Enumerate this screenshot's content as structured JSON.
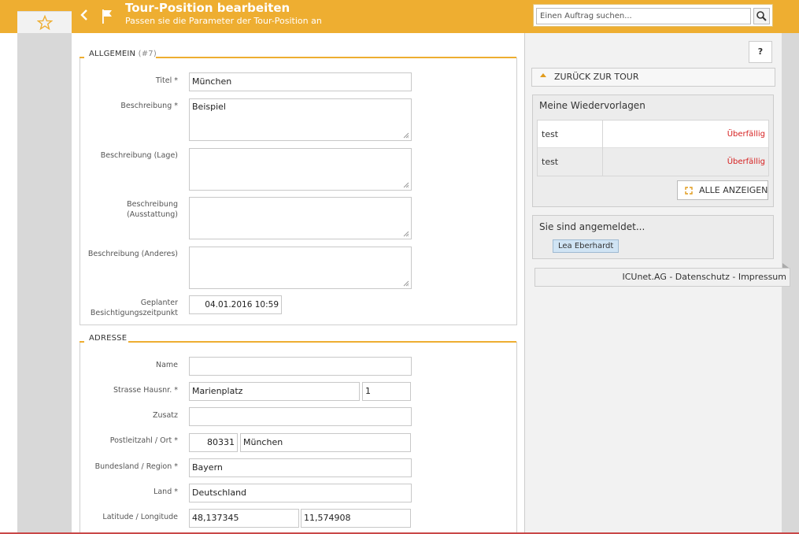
{
  "header": {
    "title": "Tour-Position bearbeiten",
    "subtitle": "Passen sie die Parameter der Tour-Position an",
    "search_placeholder": "Einen Auftrag suchen...",
    "accent_color": "#eeae31"
  },
  "general": {
    "title": "ALLGEMEIN",
    "count": "(#7)",
    "titel_label": "Titel *",
    "titel_value": "München",
    "beschreibung_label": "Beschreibung *",
    "beschreibung_value": "Beispiel",
    "lage_label": "Beschreibung (Lage)",
    "lage_value": "",
    "ausstattung_label_1": "Beschreibung",
    "ausstattung_label_2": "(Ausstattung)",
    "ausstattung_value": "",
    "anderes_label": "Beschreibung (Anderes)",
    "anderes_value": "",
    "zeitpunkt_label_1": "Geplanter",
    "zeitpunkt_label_2": "Besichtigungszeitpunkt",
    "zeitpunkt_value": "04.01.2016 10:59"
  },
  "address": {
    "title": "ADRESSE",
    "name_label": "Name",
    "name_value": "",
    "strasse_label": "Strasse Hausnr. *",
    "strasse_value": "Marienplatz",
    "hausnr_value": "1",
    "zusatz_label": "Zusatz",
    "zusatz_value": "",
    "plz_label": "Postleitzahl / Ort *",
    "plz_value": "80331",
    "ort_value": "München",
    "bundesland_label": "Bundesland / Region *",
    "bundesland_value": "Bayern",
    "land_label": "Land *",
    "land_value": "Deutschland",
    "latlng_label": "Latitude / Longitude",
    "lat_value": "48,137345",
    "lng_value": "11,574908"
  },
  "sidebar": {
    "help_label": "?",
    "back_label": "ZURÜCK ZUR TOUR",
    "wiedervorlagen_title": "Meine Wiedervorlagen",
    "wiedervorlagen": [
      {
        "name": "test",
        "status": "Überfällig"
      },
      {
        "name": "test",
        "status": "Überfällig"
      }
    ],
    "show_all_label": "ALLE ANZEIGEN",
    "logged_in_title": "Sie sind angemeldet...",
    "user_name": "Lea Eberhardt",
    "footer": "ICUnet.AG - Datenschutz - Impressum"
  }
}
